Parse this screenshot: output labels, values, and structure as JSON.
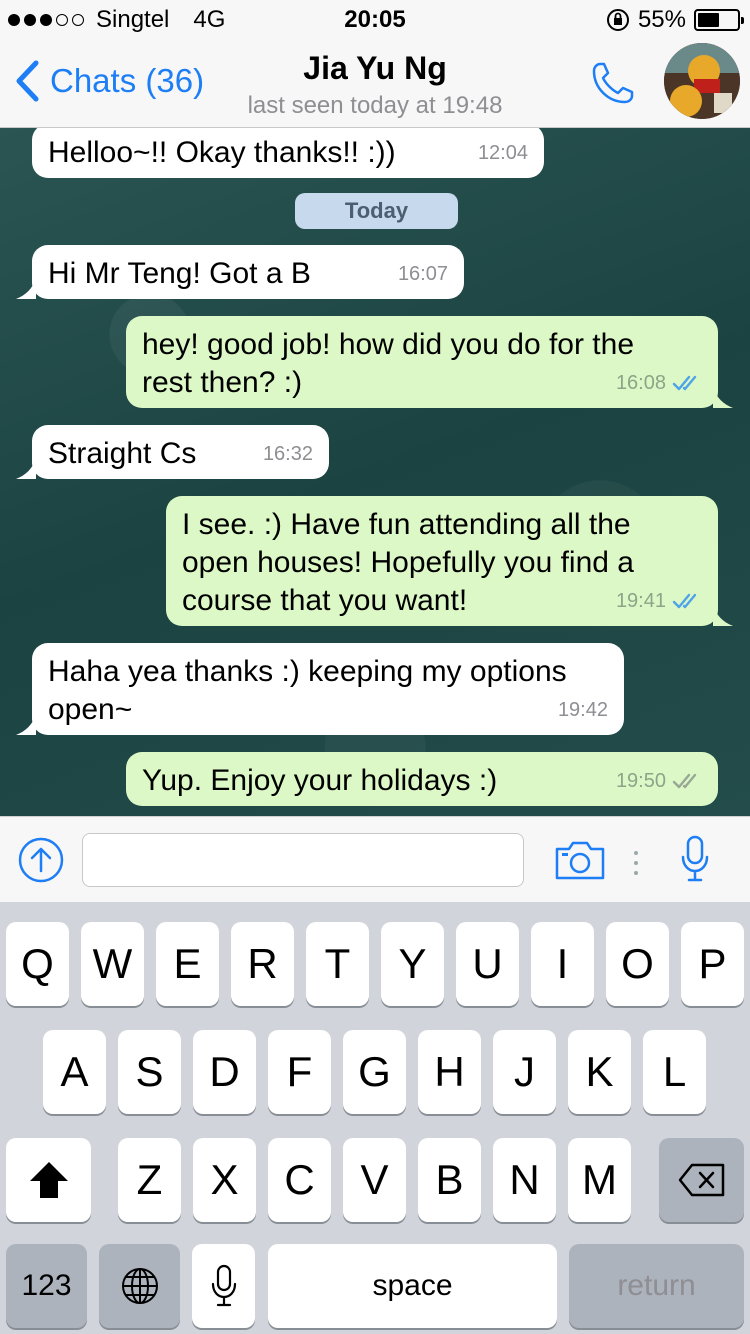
{
  "status_bar": {
    "carrier": "Singtel",
    "network": "4G",
    "time": "20:05",
    "battery_percent": "55%",
    "battery_level": 0.55,
    "signal_bars_filled": 3,
    "signal_bars_total": 5
  },
  "nav": {
    "back_label": "Chats (36)",
    "contact_name": "Jia Yu Ng",
    "last_seen": "last seen today at 19:48",
    "accent_color": "#1d7ef5"
  },
  "chat": {
    "day_separator": "Today",
    "messages": [
      {
        "direction": "incoming",
        "text": "Helloo~!! Okay thanks!! :))",
        "time": "12:04"
      },
      {
        "direction": "incoming",
        "text": "Hi Mr Teng! Got a B",
        "time": "16:07"
      },
      {
        "direction": "outgoing",
        "text_line1": "hey! good job! how did you do for the",
        "text_line2": "rest then? :)",
        "time": "16:08",
        "status": "read"
      },
      {
        "direction": "incoming",
        "text": "Straight Cs",
        "time": "16:32"
      },
      {
        "direction": "outgoing",
        "text_line1": "I see. :) Have fun attending all the",
        "text_line2": "open houses! Hopefully you find a",
        "text_line3": "course that you want!",
        "time": "19:41",
        "status": "read"
      },
      {
        "direction": "incoming",
        "text_line1": "Haha yea thanks :) keeping my options",
        "text_line2": "open~",
        "time": "19:42"
      },
      {
        "direction": "outgoing",
        "text": "Yup. Enjoy your holidays :)",
        "time": "19:50",
        "status": "delivered"
      }
    ],
    "incoming_bubble_color": "#ffffff",
    "outgoing_bubble_color": "#dcf8c6",
    "read_tick_color": "#4fa3e8"
  },
  "input_bar": {
    "upload_icon": "upload-arrow-icon",
    "camera_icon": "camera-icon",
    "mic_icon": "microphone-icon",
    "message_value": ""
  },
  "keyboard": {
    "row1": [
      "Q",
      "W",
      "E",
      "R",
      "T",
      "Y",
      "U",
      "I",
      "O",
      "P"
    ],
    "row2": [
      "A",
      "S",
      "D",
      "F",
      "G",
      "H",
      "J",
      "K",
      "L"
    ],
    "row3": [
      "Z",
      "X",
      "C",
      "V",
      "B",
      "N",
      "M"
    ],
    "numbers_key": "123",
    "space_key": "space",
    "return_key": "return",
    "shift_icon": "shift-arrow-icon",
    "delete_icon": "backspace-icon",
    "globe_icon": "globe-icon",
    "dictation_icon": "microphone-icon"
  }
}
